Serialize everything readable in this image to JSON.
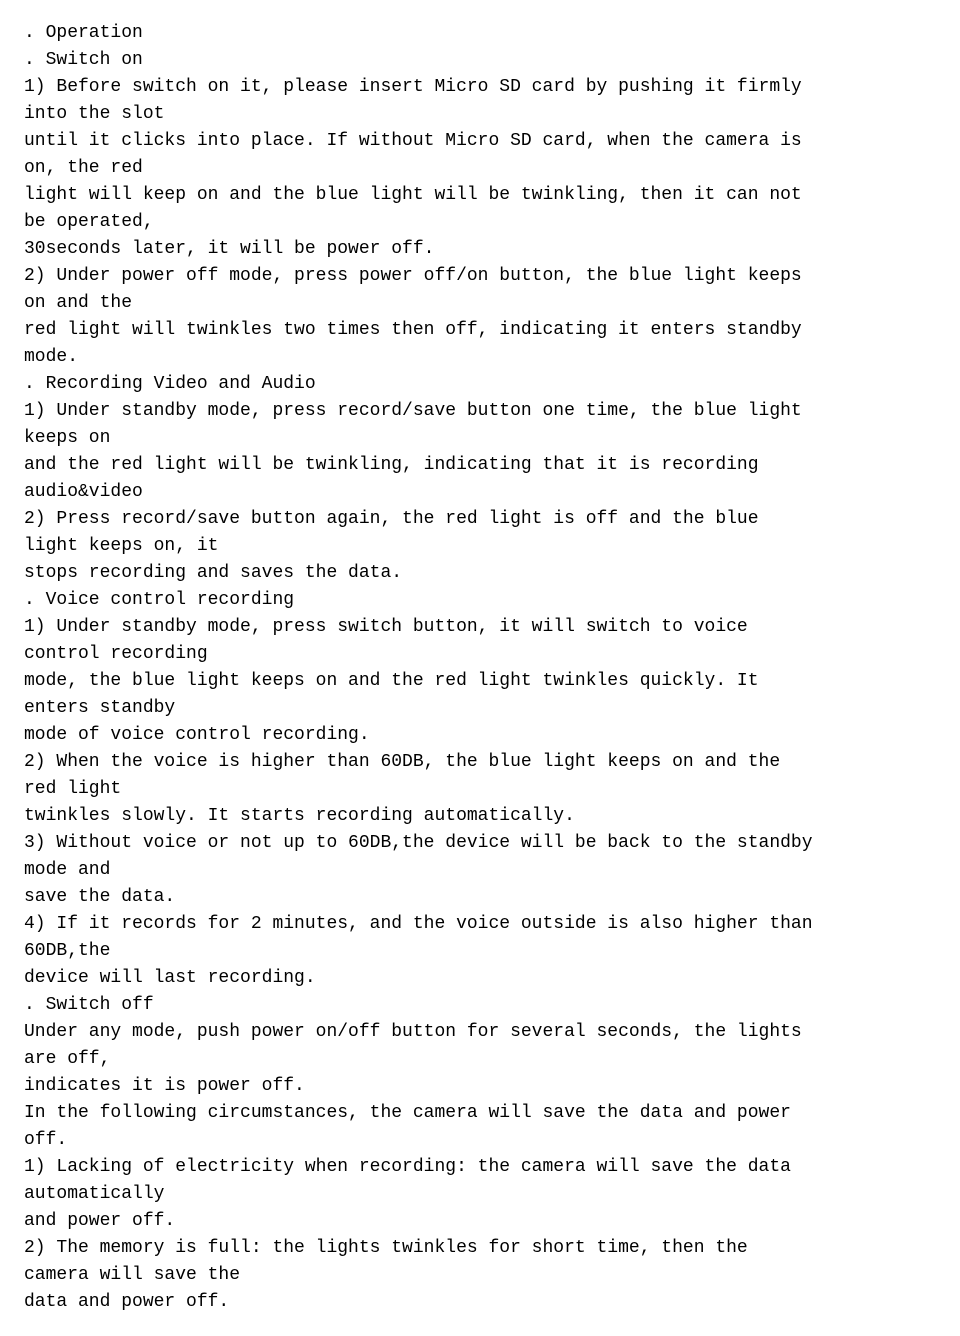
{
  "content": {
    "lines": [
      ". Operation",
      ". Switch on",
      "1) Before switch on it, please insert Micro SD card by pushing it firmly\ninto the slot",
      "until it clicks into place. If without Micro SD card, when the camera is\non, the red",
      "light will keep on and the blue light will be twinkling, then it can not\nbe operated,",
      "30seconds later, it will be power off.",
      "2) Under power off mode, press power off/on button, the blue light keeps\non and the",
      "red light will twinkles two times then off, indicating it enters standby\nmode.",
      ". Recording Video and Audio",
      "1) Under standby mode, press record/save button one time, the blue light\nkeeps on",
      "and the red light will be twinkling, indicating that it is recording\naudio&video",
      "2) Press record/save button again, the red light is off and the blue\nlight keeps on, it",
      "stops recording and saves the data.",
      ". Voice control recording",
      "1) Under standby mode, press switch button, it will switch to voice\ncontrol recording",
      "mode, the blue light keeps on and the red light twinkles quickly. It\nenters standby",
      "mode of voice control recording.",
      "2) When the voice is higher than 60DB, the blue light keeps on and the\nred light",
      "twinkles slowly. It starts recording automatically.",
      "3) Without voice or not up to 60DB,the device will be back to the standby\nmode and",
      "save the data.",
      "4) If it records for 2 minutes, and the voice outside is also higher than\n60DB,the",
      "device will last recording.",
      ". Switch off",
      "",
      "",
      "Under any mode, push power on/off button for several seconds, the lights\nare off,",
      "indicates it is power off.",
      "",
      "In the following circumstances, the camera will save the data and power\noff.",
      "",
      "1) Lacking of electricity when recording: the camera will save the data\nautomatically",
      "and power off.",
      "2) The memory is full: the lights twinkles for short time, then the\ncamera will save the",
      "data and power off."
    ]
  }
}
